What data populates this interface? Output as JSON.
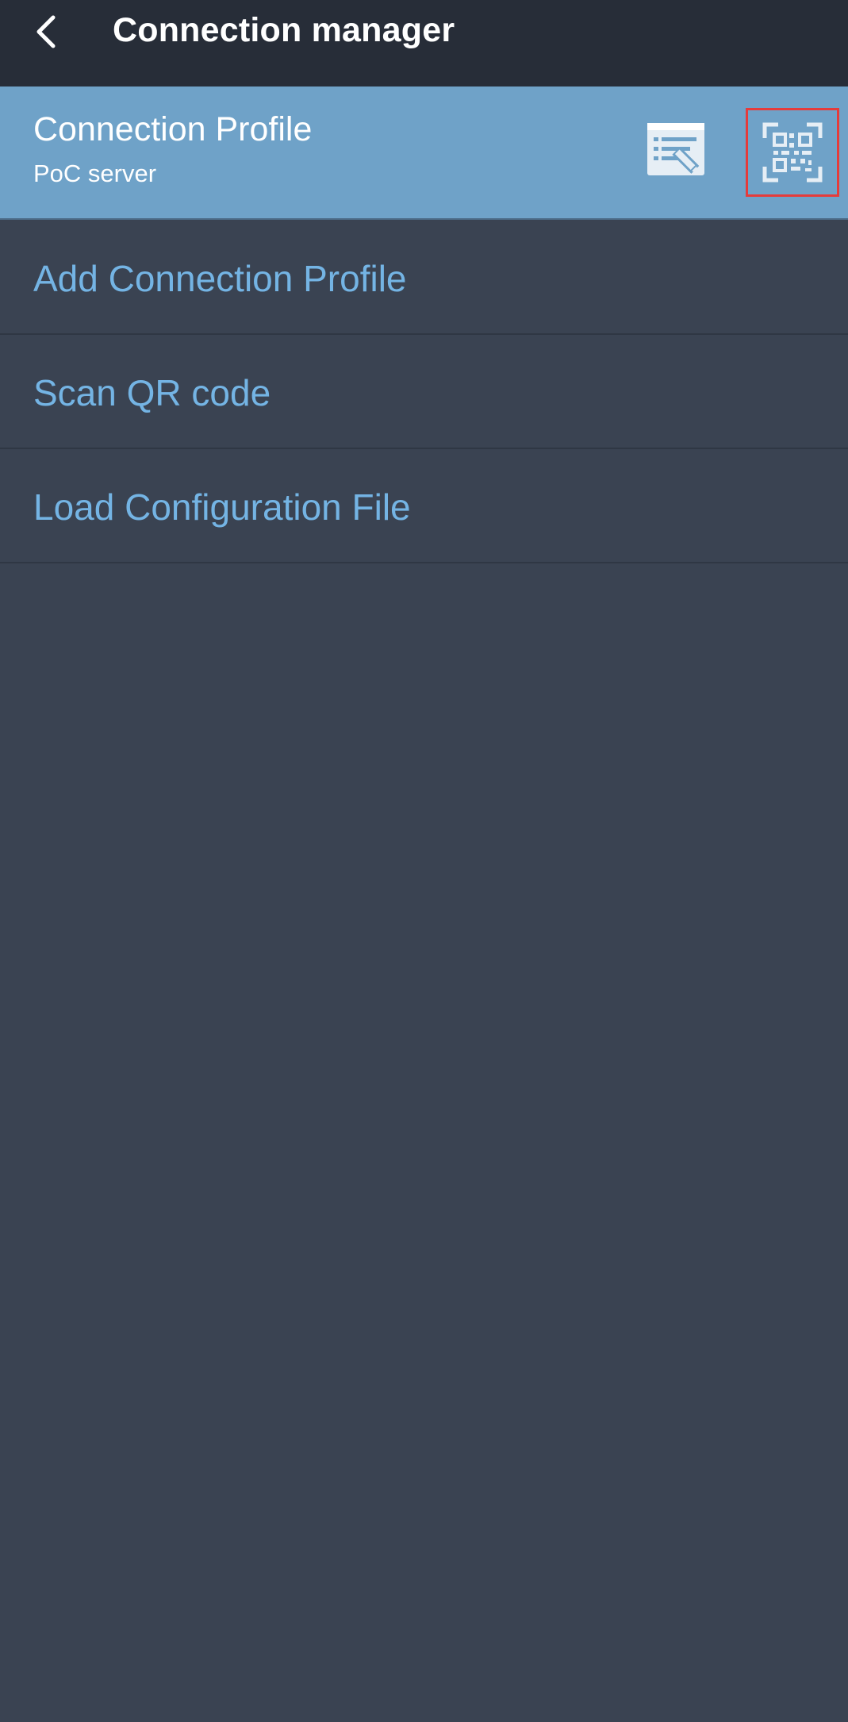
{
  "header": {
    "title": "Connection manager",
    "back_icon": "chevron-left-icon"
  },
  "profile": {
    "name": "Connection Profile",
    "server": "PoC server",
    "edit_icon": "edit-profile-icon",
    "qr_icon": "qr-code-icon",
    "highlight_color": "#e53b3b"
  },
  "menu": {
    "items": [
      {
        "label": "Add Connection Profile"
      },
      {
        "label": "Scan QR code"
      },
      {
        "label": "Load Configuration File"
      }
    ]
  },
  "colors": {
    "header_bg": "#272d38",
    "page_bg": "#3a4352",
    "profile_bg": "#6fa2c8",
    "menu_text": "#74b4e4"
  }
}
